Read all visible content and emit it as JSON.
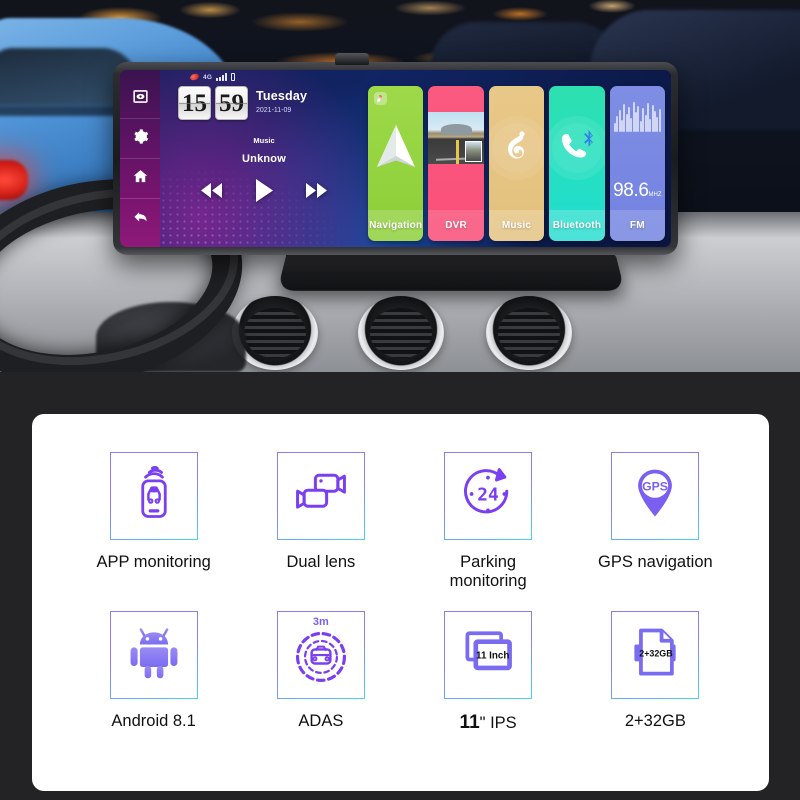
{
  "device_screen": {
    "status_bar": {
      "rec_icon": "record-icon",
      "network": "4G",
      "signal_icon": "signal-bars-icon",
      "battery_icon": "battery-icon"
    },
    "sidebar": [
      {
        "name": "camera-switch-icon",
        "label": "Camera"
      },
      {
        "name": "gear-icon",
        "label": "Settings"
      },
      {
        "name": "home-icon",
        "label": "Home"
      },
      {
        "name": "back-arrow-icon",
        "label": "Back"
      }
    ],
    "clock": {
      "hours": "15",
      "minutes": "59",
      "weekday": "Tuesday",
      "date": "2021-11-09"
    },
    "music": {
      "title": "Music",
      "artist": "Unknow",
      "prev_icon": "previous-track-icon",
      "play_icon": "play-icon",
      "next_icon": "next-track-icon"
    },
    "tiles": [
      {
        "id": "navigation",
        "label": "Navigation",
        "icon": "navigation-arrow-icon",
        "color": "#9ed94a"
      },
      {
        "id": "dvr",
        "label": "DVR",
        "icon": "road-preview-icon",
        "color": "#fb5a80"
      },
      {
        "id": "music",
        "label": "Music",
        "icon": "music-note-icon",
        "color": "#e8c888"
      },
      {
        "id": "bluetooth",
        "label": "Bluetooth",
        "icon": "bluetooth-phone-icon",
        "color": "#2ee0b0"
      },
      {
        "id": "fm",
        "label": "FM",
        "icon": "equalizer-icon",
        "color": "#7f8ee4",
        "frequency": "98.6",
        "frequency_unit": "MHZ"
      }
    ]
  },
  "features": [
    {
      "id": "app-monitoring",
      "label": "APP monitoring",
      "icon": "phone-wifi-car-icon"
    },
    {
      "id": "dual-lens",
      "label": "Dual lens",
      "icon": "dual-camera-icon"
    },
    {
      "id": "parking-monitoring",
      "label": "Parking\nmonitoring",
      "icon": "24h-clock-icon",
      "icon_text": "24"
    },
    {
      "id": "gps-navigation",
      "label": "GPS navigation",
      "icon": "map-pin-icon",
      "icon_text": "GPS"
    },
    {
      "id": "android",
      "label": "Android 8.1",
      "icon": "android-robot-icon"
    },
    {
      "id": "adas",
      "label": "ADAS",
      "icon": "adas-car-radar-icon",
      "icon_tag": "3m"
    },
    {
      "id": "ips-screen",
      "label_prefix": "11",
      "label_suffix": "\" IPS",
      "icon": "screen-icon",
      "icon_text": "11 Inch"
    },
    {
      "id": "memory",
      "label": "2+32GB",
      "icon": "storage-document-icon",
      "icon_text": "2+32GB"
    }
  ],
  "colors": {
    "page_background": "#232325",
    "card_background": "#ffffff",
    "icon_purple": "#7a3ff0",
    "icon_blue": "#46d3f5",
    "accent_violet": "#8f7bf0"
  }
}
